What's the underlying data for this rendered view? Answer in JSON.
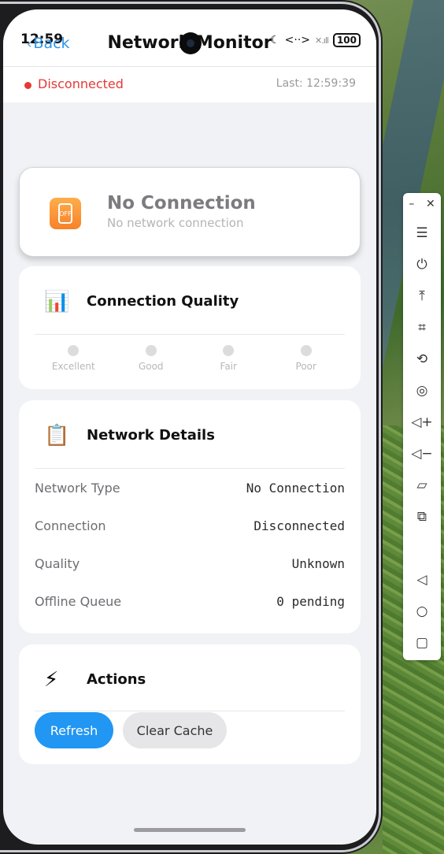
{
  "status_bar": {
    "time": "12:59",
    "dnd_icon": "moon-icon",
    "data_icon": "<··>",
    "signal": "✕.ıll",
    "battery": "100"
  },
  "header": {
    "back_label": "Back",
    "title": "Network Monitor"
  },
  "connection_bar": {
    "status": "Disconnected",
    "last_updated": "Last: 12:59:39",
    "status_color": "#e53935"
  },
  "hero": {
    "icon": "phone-off-icon",
    "icon_text": "OFF",
    "title": "No Connection",
    "subtitle": "No network connection"
  },
  "quality": {
    "icon": "📊",
    "title": "Connection Quality",
    "levels": [
      "Excellent",
      "Good",
      "Fair",
      "Poor"
    ]
  },
  "details": {
    "icon": "📋",
    "title": "Network Details",
    "rows": [
      {
        "label": "Network Type",
        "value": "No Connection"
      },
      {
        "label": "Connection",
        "value": "Disconnected"
      },
      {
        "label": "Quality",
        "value": "Unknown"
      },
      {
        "label": "Offline Queue",
        "value": "0 pending"
      }
    ]
  },
  "actions": {
    "icon": "⚡",
    "title": "Actions",
    "refresh_label": "Refresh",
    "clear_cache_label": "Clear Cache"
  },
  "toolbar": {
    "minimize": "–",
    "close": "✕",
    "items": [
      {
        "name": "menu-icon",
        "glyph": "☰"
      },
      {
        "name": "power-icon",
        "glyph": "⏻"
      },
      {
        "name": "upload-icon",
        "glyph": "⤒"
      },
      {
        "name": "crop-icon",
        "glyph": "⌗"
      },
      {
        "name": "rotate-icon",
        "glyph": "⟲"
      },
      {
        "name": "location-icon",
        "glyph": "◎"
      },
      {
        "name": "volume-up-icon",
        "glyph": "◁+"
      },
      {
        "name": "volume-down-icon",
        "glyph": "◁−"
      },
      {
        "name": "shake-icon",
        "glyph": "▱"
      },
      {
        "name": "devices-icon",
        "glyph": "⧉"
      },
      {
        "name": "back-icon",
        "glyph": "◁"
      },
      {
        "name": "home-icon",
        "glyph": "○"
      },
      {
        "name": "recents-icon",
        "glyph": "▢"
      }
    ]
  }
}
